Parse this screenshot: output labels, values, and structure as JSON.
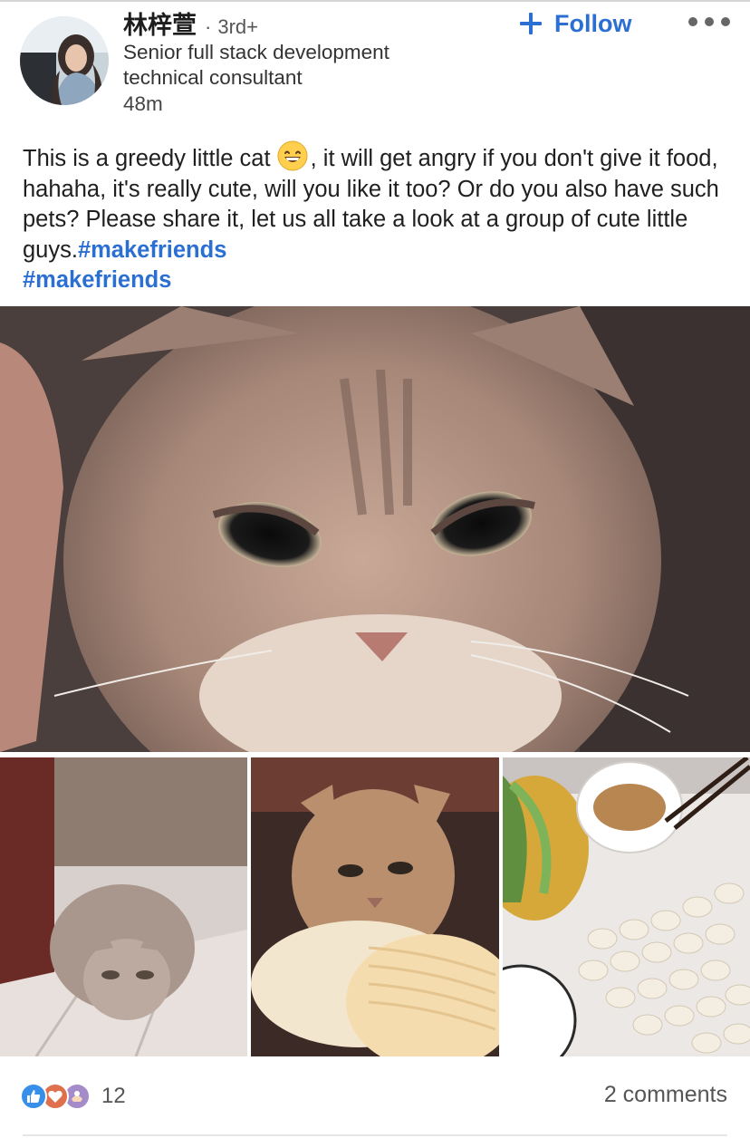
{
  "author": {
    "name": "林梓萱",
    "degree_separator": "·",
    "degree": "3rd+",
    "headline": "Senior full stack development technical consultant",
    "time": "48m"
  },
  "actions": {
    "follow_label": "Follow"
  },
  "post": {
    "text_part1": "This is a greedy little cat ",
    "emoji": "grinning-face",
    "text_part2": ", it will get angry if you don't give it food, hahaha, it's really cute, will you like it too? Or do you also have such pets? Please share it, let us all take a look at a group of cute little guys.",
    "hashtags": [
      "#makefriends",
      "#makefriends"
    ]
  },
  "media": {
    "main": "grumpy tabby cat close-up",
    "thumbs": [
      "cat crouching on tiled floor",
      "cat sitting on pillow",
      "dumplings, greens and sauce bowl"
    ]
  },
  "social": {
    "reaction_icons": [
      "like-icon",
      "love-icon",
      "support-icon"
    ],
    "reaction_count": "12",
    "comments_label": "2 comments"
  },
  "colors": {
    "accent": "#2b6fd3",
    "like": "#378fe9",
    "love": "#df704d",
    "support": "#a38cc9"
  }
}
